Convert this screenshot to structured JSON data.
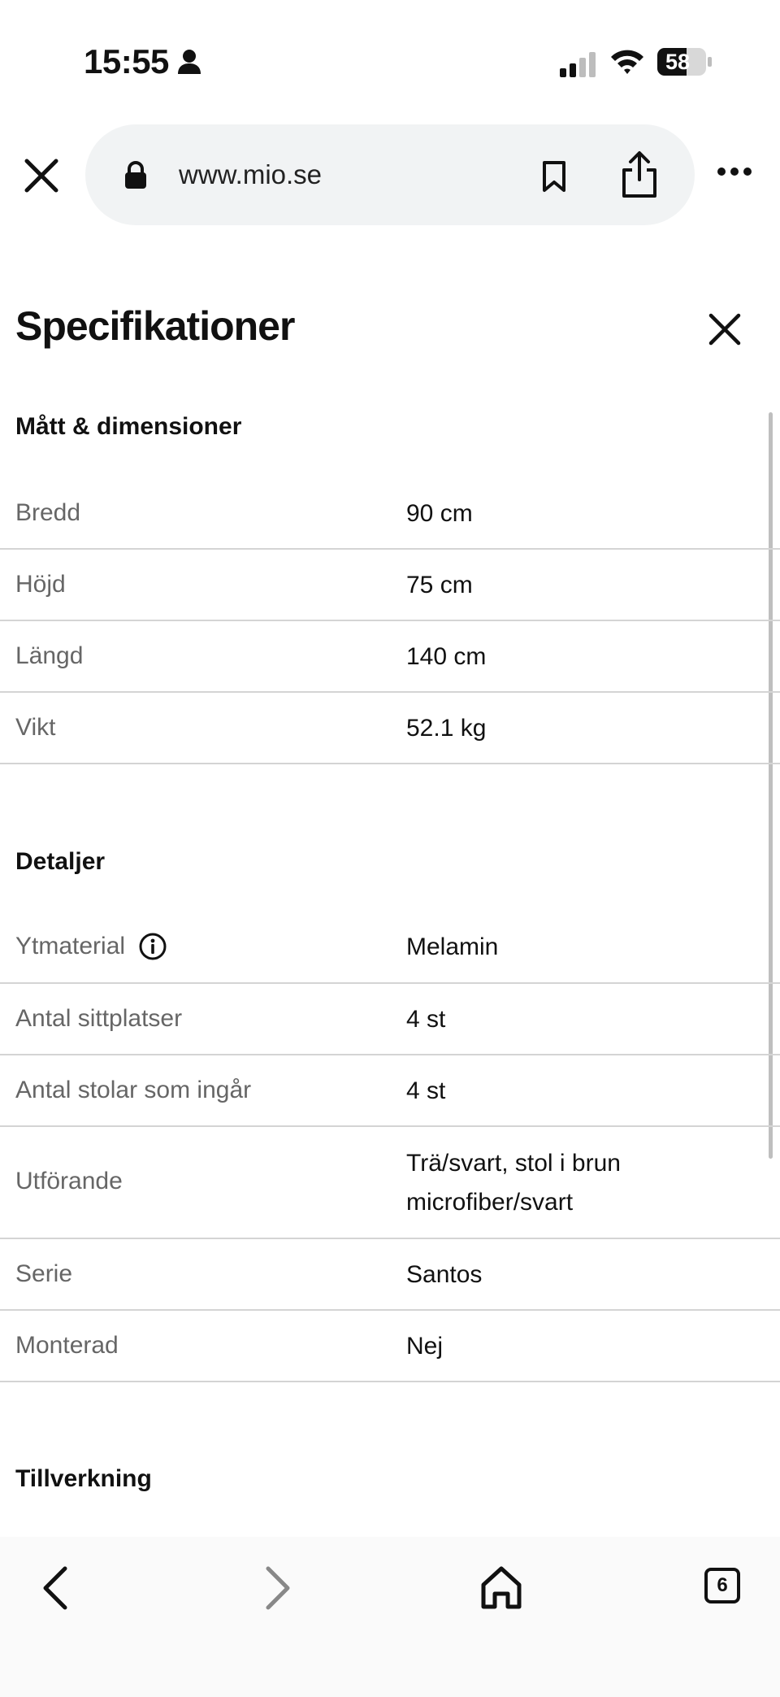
{
  "status": {
    "time": "15:55",
    "battery": "58"
  },
  "browser": {
    "url": "www.mio.se",
    "tab_count": "6"
  },
  "panel": {
    "title": "Specifikationer"
  },
  "sections": {
    "dimensions": {
      "title": "Mått & dimensioner",
      "rows": [
        {
          "label": "Bredd",
          "value": "90 cm"
        },
        {
          "label": "Höjd",
          "value": "75 cm"
        },
        {
          "label": "Längd",
          "value": "140 cm"
        },
        {
          "label": "Vikt",
          "value": "52.1 kg"
        }
      ]
    },
    "details": {
      "title": "Detaljer",
      "rows": [
        {
          "label": "Ytmaterial",
          "value": "Melamin"
        },
        {
          "label": "Antal sittplatser",
          "value": "4 st"
        },
        {
          "label": "Antal stolar som ingår",
          "value": "4 st"
        },
        {
          "label": "Utförande",
          "value_line1": "Trä/svart, stol i brun",
          "value_line2": "microfiber/svart"
        },
        {
          "label": "Serie",
          "value": "Santos"
        },
        {
          "label": "Monterad",
          "value": "Nej"
        }
      ]
    },
    "manufacturing": {
      "title": "Tillverkning"
    }
  }
}
